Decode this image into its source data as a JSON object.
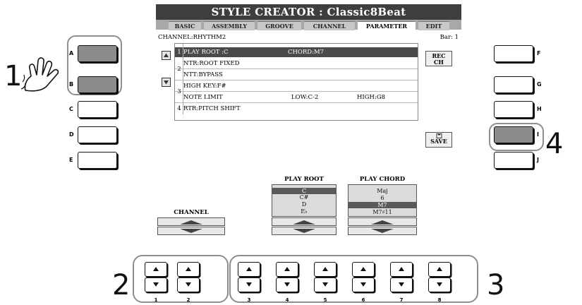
{
  "screen": {
    "title": "STYLE CREATOR : Classic8Beat",
    "tabs": [
      "BASIC",
      "ASSEMBLY",
      "GROOVE",
      "CHANNEL",
      "PARAMETER",
      "EDIT"
    ],
    "active_tab": "PARAMETER",
    "channel_label": "CHANNEL:RHYTHM2",
    "bar_label": "Bar:  1",
    "rec_ch": "REC\nCH",
    "save_label": "SAVE",
    "params": [
      {
        "num": "1",
        "text": "PLAY ROOT    :C",
        "text2": "CHORD:M7",
        "selected": true
      },
      {
        "num": "",
        "text": "NTR:ROOT FIXED"
      },
      {
        "num": "2",
        "text": "NTT:BYPASS"
      },
      {
        "num": "",
        "text": "HIGH KEY:F#"
      },
      {
        "num": "3",
        "text": "NOTE LIMIT",
        "low": "LOW:C-2",
        "high": "HIGH:G8"
      },
      {
        "num": "4",
        "text": "RTR:PITCH SHIFT"
      }
    ],
    "channel_dial_label": "CHANNEL",
    "play_root": {
      "label": "PLAY ROOT",
      "items": [
        "C",
        "C#",
        "D",
        "E♭"
      ],
      "selected": "C"
    },
    "play_chord": {
      "label": "PLAY CHORD",
      "items": [
        "Maj",
        "6",
        "M7",
        "M7♯11"
      ],
      "selected": "M7"
    }
  },
  "left_buttons": [
    "A",
    "B",
    "C",
    "D",
    "E"
  ],
  "right_buttons": [
    "F",
    "G",
    "H",
    "I",
    "J"
  ],
  "pressed_buttons": [
    "A",
    "B",
    "I"
  ],
  "bottom_buttons": [
    "1",
    "2",
    "3",
    "4",
    "5",
    "6",
    "7",
    "8"
  ],
  "steps": {
    "step1": "1",
    "step2": "2",
    "step3": "3",
    "step4": "4"
  },
  "icons": {
    "scroll_up": "triangle-up-icon",
    "scroll_down": "triangle-down-icon",
    "pointing_hand": "hand-icon",
    "save": "save-icon"
  }
}
